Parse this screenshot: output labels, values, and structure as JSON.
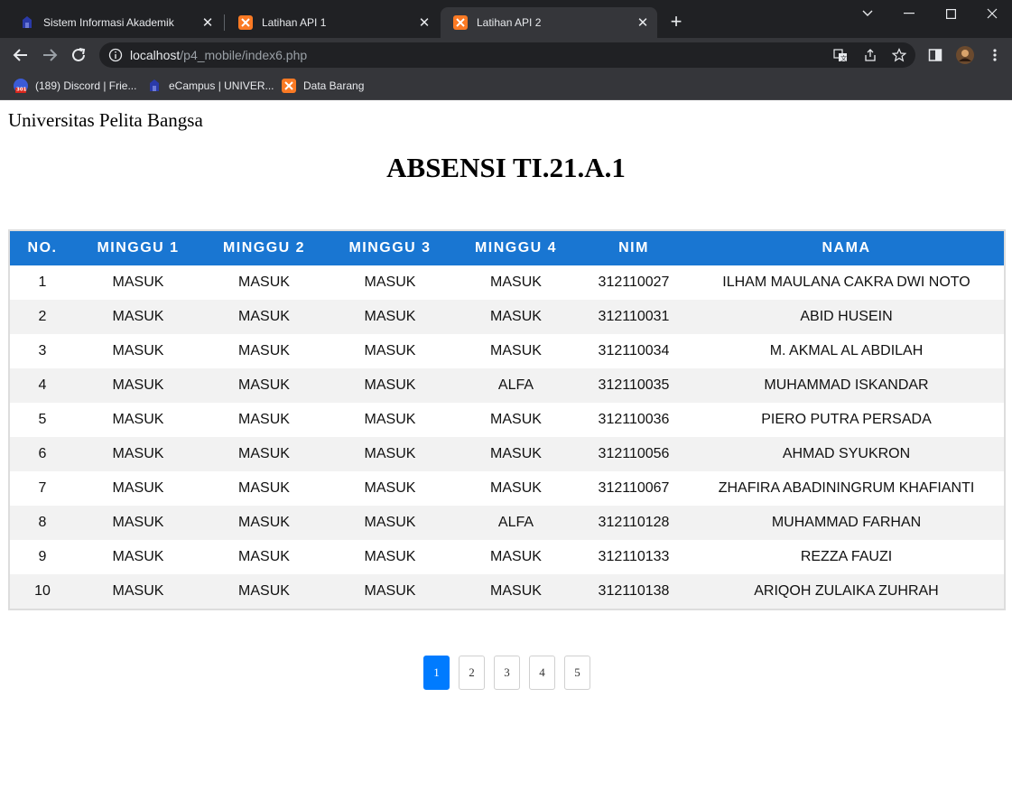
{
  "browser": {
    "tabs": [
      {
        "title": "Sistem Informasi Akademik",
        "icon": "campus-icon",
        "active": false
      },
      {
        "title": "Latihan API 1",
        "icon": "xampp-icon",
        "active": false
      },
      {
        "title": "Latihan API 2",
        "icon": "xampp-icon",
        "active": true
      }
    ],
    "url_host": "localhost",
    "url_path": "/p4_mobile/index6.php",
    "bookmarks": [
      {
        "label": "(189) Discord | Frie...",
        "icon": "discord-icon"
      },
      {
        "label": "eCampus | UNIVER...",
        "icon": "campus-icon"
      },
      {
        "label": "Data Barang",
        "icon": "xampp-icon"
      }
    ]
  },
  "page": {
    "university": "Universitas Pelita Bangsa",
    "title": "ABSENSI TI.21.A.1",
    "table": {
      "headers": [
        "NO.",
        "MINGGU 1",
        "MINGGU 2",
        "MINGGU 3",
        "MINGGU 4",
        "NIM",
        "NAMA"
      ],
      "rows": [
        [
          "1",
          "MASUK",
          "MASUK",
          "MASUK",
          "MASUK",
          "312110027",
          "ILHAM MAULANA CAKRA DWI NOTO"
        ],
        [
          "2",
          "MASUK",
          "MASUK",
          "MASUK",
          "MASUK",
          "312110031",
          "ABID HUSEIN"
        ],
        [
          "3",
          "MASUK",
          "MASUK",
          "MASUK",
          "MASUK",
          "312110034",
          "M. AKMAL AL ABDILAH"
        ],
        [
          "4",
          "MASUK",
          "MASUK",
          "MASUK",
          "ALFA",
          "312110035",
          "MUHAMMAD ISKANDAR"
        ],
        [
          "5",
          "MASUK",
          "MASUK",
          "MASUK",
          "MASUK",
          "312110036",
          "PIERO PUTRA PERSADA"
        ],
        [
          "6",
          "MASUK",
          "MASUK",
          "MASUK",
          "MASUK",
          "312110056",
          "AHMAD SYUKRON"
        ],
        [
          "7",
          "MASUK",
          "MASUK",
          "MASUK",
          "MASUK",
          "312110067",
          "ZHAFIRA ABADININGRUM KHAFIANTI"
        ],
        [
          "8",
          "MASUK",
          "MASUK",
          "MASUK",
          "ALFA",
          "312110128",
          "MUHAMMAD FARHAN"
        ],
        [
          "9",
          "MASUK",
          "MASUK",
          "MASUK",
          "MASUK",
          "312110133",
          "REZZA FAUZI"
        ],
        [
          "10",
          "MASUK",
          "MASUK",
          "MASUK",
          "MASUK",
          "312110138",
          "ARIQOH ZULAIKA ZUHRAH"
        ]
      ]
    },
    "pagination": {
      "pages": [
        "1",
        "2",
        "3",
        "4",
        "5"
      ],
      "current": "1"
    }
  },
  "colors": {
    "header_bg": "#1976d2",
    "active_page": "#007bff",
    "row_stripe": "#f2f2f2"
  }
}
